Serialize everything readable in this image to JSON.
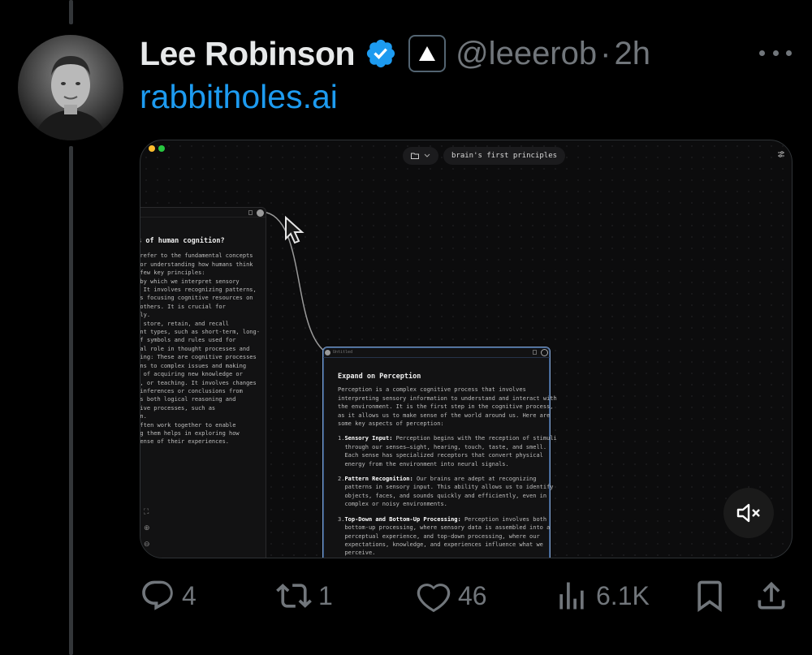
{
  "tweet": {
    "author_name": "Lee Robinson",
    "handle": "@leeerob",
    "separator": "·",
    "time": "2h",
    "link_text": "rabbitholes.ai"
  },
  "media": {
    "breadcrumb": "brain's first principles",
    "left_card": {
      "heading": "es of human cognition?",
      "lines": [
        "n refer to the fundamental concepts",
        " for understanding how humans think",
        "a few key principles:",
        "",
        "s by which we interpret sensory",
        "t. It involves recognizing patterns,",
        "",
        "",
        "ves focusing cognitive resources on",
        "g others. It is crucial for",
        "ntly.",
        "",
        "to store, retain, and recall",
        "rent types, such as short-term, long-",
        "",
        "",
        " of symbols and rules used for",
        "ical role in thought processes and",
        "",
        "",
        "aking: These are cognitive processes",
        "ions to complex issues and making",
        "",
        "",
        "ss of acquiring new knowledge or",
        "dy, or teaching. It involves changes",
        "",
        "",
        "g inferences or conclusions from",
        "des both logical reasoning and",
        "",
        "",
        "itive processes, such as",
        "ion.",
        "",
        " often work together to enable",
        "ing them helps in exploring how",
        " sense of their experiences."
      ]
    },
    "main_card": {
      "toolbar_label": "Untitled",
      "heading": "Expand on Perception",
      "intro": [
        "Perception is a complex cognitive process that involves",
        "interpreting sensory information to understand and interact with",
        "the environment. It is the first step in the cognitive process,",
        "as it allows us to make sense of the world around us. Here are",
        "some key aspects of perception:"
      ],
      "items": [
        {
          "num": "1.",
          "title": "Sensory Input:",
          "lines": [
            " Perception begins with the reception of stimuli",
            "through our senses—sight, hearing, touch, taste, and smell.",
            "Each sense has specialized receptors that convert physical",
            "energy from the environment into neural signals."
          ]
        },
        {
          "num": "2.",
          "title": "Pattern Recognition:",
          "lines": [
            " Our brains are adept at recognizing",
            "patterns in sensory input. This ability allows us to identify",
            "objects, faces, and sounds quickly and efficiently, even in",
            "complex or noisy environments."
          ]
        },
        {
          "num": "3.",
          "title": "Top-Down and Bottom-Up Processing:",
          "lines": [
            " Perception involves both",
            "bottom-up processing, where sensory data is assembled into a",
            "perceptual experience, and top-down processing, where our",
            "expectations, knowledge, and experiences influence what we",
            "perceive."
          ]
        }
      ]
    }
  },
  "actions": {
    "replies": "4",
    "reposts": "1",
    "likes": "46",
    "views": "6.1K"
  },
  "colors": {
    "link": "#1d9bf0",
    "verified": "#1d9bf0",
    "muted_text": "#71767b",
    "background": "#000000"
  },
  "icons": [
    "verified-badge-icon",
    "vercel-triangle-icon",
    "more-icon",
    "reply-icon",
    "repost-icon",
    "like-icon",
    "views-icon",
    "bookmark-icon",
    "share-icon",
    "mute-icon"
  ]
}
